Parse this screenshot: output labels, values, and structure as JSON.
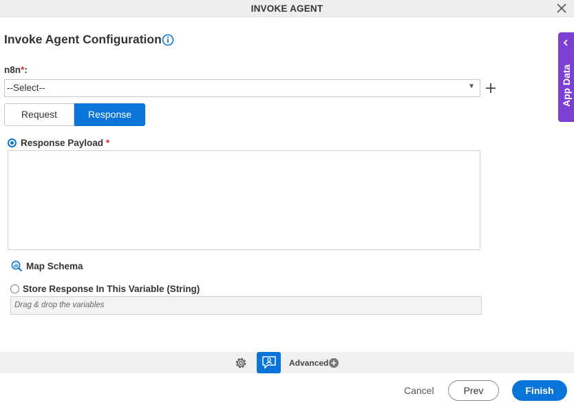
{
  "window": {
    "title": "INVOKE AGENT"
  },
  "page": {
    "title": "Invoke Agent Configuration"
  },
  "connection": {
    "label": "n8n",
    "required_mark": "*",
    "label_suffix": ":",
    "selected_value": "--Select--"
  },
  "tabs": [
    {
      "label": "Request",
      "active": false
    },
    {
      "label": "Response",
      "active": true
    }
  ],
  "response_payload": {
    "label": "Response Payload",
    "required_mark": "*",
    "value": ""
  },
  "map_schema": {
    "label": "Map Schema"
  },
  "store_variable": {
    "label": "Store Response In This Variable (String)",
    "placeholder": "Drag & drop the variables"
  },
  "app_data": {
    "label": "App Data"
  },
  "toolbar": {
    "advanced_label": "Advanced"
  },
  "footer": {
    "cancel_label": "Cancel",
    "prev_label": "Prev",
    "finish_label": "Finish"
  },
  "colors": {
    "primary": "#0a74d9",
    "app_data_tab": "#7b3fd1",
    "required": "#d9262c"
  }
}
